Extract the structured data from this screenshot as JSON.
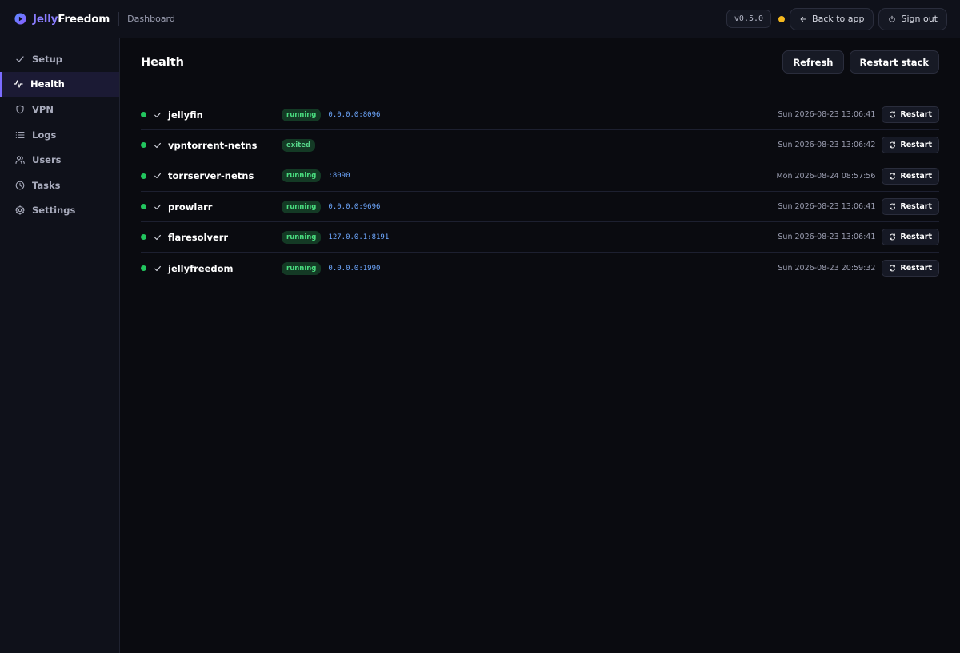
{
  "app": {
    "brand_part1": "Jelly",
    "brand_part2": "Freedom",
    "breadcrumb": "Dashboard",
    "version": "v0.5.0",
    "back_label": "Back to app",
    "signout_label": "Sign out"
  },
  "colors": {
    "accent": "#7b6cff",
    "status_ok": "#22c55e",
    "status_warn": "#f5b81e",
    "port": "#6ea8ff"
  },
  "sidebar": {
    "items": [
      {
        "label": "Setup",
        "icon": "check-icon"
      },
      {
        "label": "Health",
        "icon": "activity-icon",
        "active": true
      },
      {
        "label": "VPN",
        "icon": "shield-icon"
      },
      {
        "label": "Logs",
        "icon": "list-icon"
      },
      {
        "label": "Users",
        "icon": "users-icon"
      },
      {
        "label": "Tasks",
        "icon": "clock-icon"
      },
      {
        "label": "Settings",
        "icon": "gear-icon"
      }
    ]
  },
  "main": {
    "title": "Health",
    "refresh_label": "Refresh",
    "restart_stack_label": "Restart stack",
    "restart_label": "Restart",
    "services": [
      {
        "name": "jellyfin",
        "status": "running",
        "port": "0.0.0.0:8096",
        "time": "Sun 2026-08-23 13:06:41"
      },
      {
        "name": "vpntorrent-netns",
        "status": "exited",
        "port": "",
        "time": "Sun 2026-08-23 13:06:42"
      },
      {
        "name": "torrserver-netns",
        "status": "running",
        "port": ":8090",
        "time": "Mon 2026-08-24 08:57:56"
      },
      {
        "name": "prowlarr",
        "status": "running",
        "port": "0.0.0.0:9696",
        "time": "Sun 2026-08-23 13:06:41"
      },
      {
        "name": "flaresolverr",
        "status": "running",
        "port": "127.0.0.1:8191",
        "time": "Sun 2026-08-23 13:06:41"
      },
      {
        "name": "jellyfreedom",
        "status": "running",
        "port": "0.0.0.0:1990",
        "time": "Sun 2026-08-23 20:59:32"
      }
    ]
  }
}
